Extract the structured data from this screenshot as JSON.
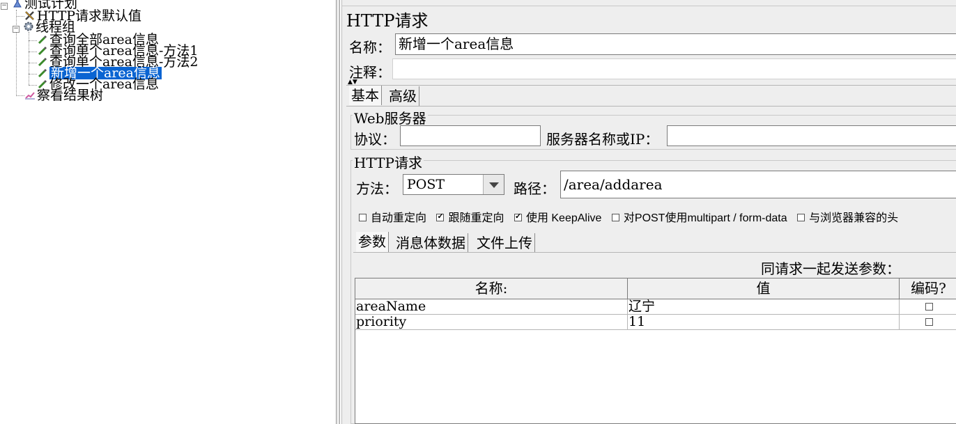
{
  "tree": {
    "items": [
      {
        "label": "测试计划",
        "icon": "test-plan-icon"
      },
      {
        "label": "HTTP请求默认值",
        "icon": "wrench-icon"
      },
      {
        "label": "线程组",
        "icon": "gear-icon"
      },
      {
        "label": "查询全部area信息",
        "icon": "pipette-icon"
      },
      {
        "label": "查询单个area信息-方法1",
        "icon": "pipette-icon"
      },
      {
        "label": "查询单个area信息-方法2",
        "icon": "pipette-icon"
      },
      {
        "label": "新增一个area信息",
        "icon": "pipette-icon",
        "selected": true
      },
      {
        "label": "修改一个area信息",
        "icon": "pipette-icon"
      },
      {
        "label": "察看结果树",
        "icon": "result-tree-icon"
      }
    ]
  },
  "panel": {
    "title": "HTTP请求",
    "name_label": "名称：",
    "name_value": "新增一个area信息",
    "comment_label": "注释：",
    "comment_value": "",
    "tabs": [
      {
        "label": "基本",
        "active": true
      },
      {
        "label": "高级",
        "active": false
      }
    ],
    "web_server": {
      "group_title": "Web服务器",
      "protocol_label": "协议：",
      "protocol_value": "",
      "server_label": "服务器名称或IP：",
      "server_value": ""
    },
    "http_request": {
      "group_title": "HTTP请求",
      "method_label": "方法：",
      "method_value": "POST",
      "path_label": "路径：",
      "path_value": "/area/addarea"
    },
    "options": [
      {
        "label": "自动重定向",
        "checked": false
      },
      {
        "label": "跟随重定向",
        "checked": true
      },
      {
        "label": "使用 KeepAlive",
        "checked": true
      },
      {
        "label": "对POST使用multipart / form-data",
        "checked": false
      },
      {
        "label": "与浏览器兼容的头",
        "checked": false
      }
    ],
    "sub_tabs": [
      {
        "label": "参数",
        "active": true
      },
      {
        "label": "消息体数据",
        "active": false
      },
      {
        "label": "文件上传",
        "active": false
      }
    ],
    "send_params_label": "同请求一起发送参数：",
    "table": {
      "headers": [
        "名称:",
        "值",
        "编码?"
      ],
      "rows": [
        {
          "name": "areaName",
          "value": "辽宁",
          "encode": false
        },
        {
          "name": "priority",
          "value": "11",
          "encode": false
        }
      ]
    }
  },
  "colors": {
    "selection": "#0a64d2",
    "panel_bg": "#eeeeee"
  }
}
